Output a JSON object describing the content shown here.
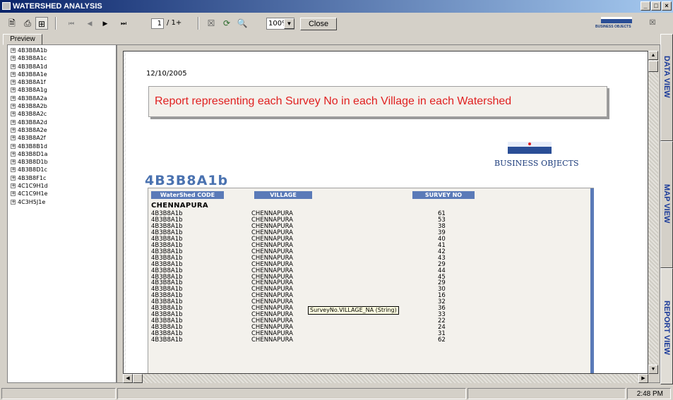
{
  "window": {
    "title": "WATERSHED ANALYSIS"
  },
  "toolbar": {
    "page_current": "1",
    "page_total": "/ 1+",
    "zoom": "100%",
    "close_label": "Close",
    "brand_small": "BUSINESS OBJECTS"
  },
  "preview_tab": {
    "label": "Preview"
  },
  "tree": {
    "items": [
      "4B3B8A1b",
      "4B3B8A1c",
      "4B3B8A1d",
      "4B3B8A1e",
      "4B3B8A1f",
      "4B3B8A1g",
      "4B3B8A2a",
      "4B3B8A2b",
      "4B3B8A2c",
      "4B3B8A2d",
      "4B3B8A2e",
      "4B3B8A2f",
      "4B3B8B1d",
      "4B3B8D1a",
      "4B3B8D1b",
      "4B3B8D1c",
      "4B3B8F1c",
      "4C1C9H1d",
      "4C1C9H1e",
      "4C3H5J1e"
    ]
  },
  "report": {
    "date": "12/10/2005",
    "title": "Report representing each Survey No in each Village in each Watershed",
    "logo_text": "BUSINESS OBJECTS",
    "group_header": "4B3B8A1b",
    "columns": [
      "WaterShed CODE",
      "VILLAGE",
      "SURVEY NO"
    ],
    "village_group": "CHENNAPURA",
    "rows": [
      [
        "4B3B8A1b",
        "CHENNAPURA",
        "61"
      ],
      [
        "4B3B8A1b",
        "CHENNAPURA",
        "53"
      ],
      [
        "4B3B8A1b",
        "CHENNAPURA",
        "38"
      ],
      [
        "4B3B8A1b",
        "CHENNAPURA",
        "39"
      ],
      [
        "4B3B8A1b",
        "CHENNAPURA",
        "40"
      ],
      [
        "4B3B8A1b",
        "CHENNAPURA",
        "41"
      ],
      [
        "4B3B8A1b",
        "CHENNAPURA",
        "42"
      ],
      [
        "4B3B8A1b",
        "CHENNAPURA",
        "43"
      ],
      [
        "4B3B8A1b",
        "CHENNAPURA",
        "29"
      ],
      [
        "4B3B8A1b",
        "CHENNAPURA",
        "44"
      ],
      [
        "4B3B8A1b",
        "CHENNAPURA",
        "45"
      ],
      [
        "4B3B8A1b",
        "CHENNAPURA",
        "29"
      ],
      [
        "4B3B8A1b",
        "CHENNAPURA",
        "30"
      ],
      [
        "4B3B8A1b",
        "CHENNAPURA",
        "16"
      ],
      [
        "4B3B8A1b",
        "CHENNAPURA",
        "32"
      ],
      [
        "4B3B8A1b",
        "CHENNAPURA",
        "36"
      ],
      [
        "4B3B8A1b",
        "CHENNAPURA",
        "33"
      ],
      [
        "4B3B8A1b",
        "CHENNAPURA",
        "22"
      ],
      [
        "4B3B8A1b",
        "CHENNAPURA",
        "24"
      ],
      [
        "4B3B8A1b",
        "CHENNAPURA",
        "31"
      ],
      [
        "4B3B8A1b",
        "CHENNAPURA",
        "62"
      ]
    ],
    "tooltip": "SurveyNo.VILLAGE_NA (String)"
  },
  "side_tabs": [
    "DATA VIEW",
    "MAP VIEW",
    "REPORT VIEW"
  ],
  "status": {
    "time": "2:48 PM"
  },
  "colors": {
    "title_red": "#e02020",
    "header_blue": "#5a7ab8",
    "brand_blue": "#1a3a7a"
  }
}
